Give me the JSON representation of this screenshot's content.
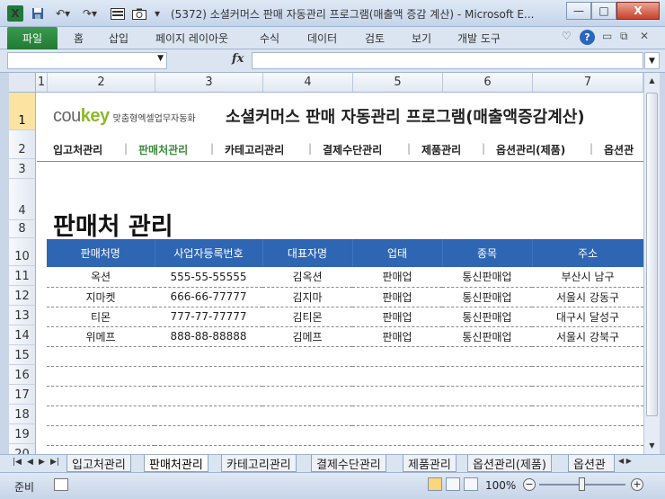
{
  "window": {
    "title": "(5372) 소셜커머스 판매 자동관리 프로그램(매출액 증감 계산) - Microsoft E...",
    "minimize": "—",
    "maximize": "□",
    "close": "X",
    "app_icon": "X",
    "icons": [
      "excel-icon",
      "save-icon",
      "undo-icon",
      "redo-icon",
      "form-icon",
      "camera-icon",
      "customize-icon"
    ]
  },
  "ribbon": {
    "file": "파일",
    "tabs": [
      "홈",
      "삽입",
      "페이지 레이아웃",
      "수식",
      "데이터",
      "검토",
      "보기",
      "개발 도구"
    ],
    "help": "?"
  },
  "formula_bar": {
    "name_box": "",
    "fx": "fx",
    "formula": ""
  },
  "columns": [
    "1",
    "2",
    "3",
    "4",
    "5",
    "6",
    "7"
  ],
  "rows": [
    "1",
    "2",
    "3",
    "4",
    "8",
    "10",
    "11",
    "12",
    "13",
    "14",
    "15",
    "16",
    "17",
    "18",
    "19",
    "20"
  ],
  "header": {
    "brand_prefix": "cou",
    "brand_suffix": "key",
    "tagline": "맞춤형엑셀업무자동화",
    "title": "소셜커머스 판매 자동관리 프로그램(매출액증감계산)"
  },
  "nav": {
    "items": [
      "입고처관리",
      "판매처관리",
      "카테고리관리",
      "결제수단관리",
      "제품관리",
      "옵션관리(제품)",
      "옵션관"
    ],
    "separator": "|",
    "active_index": 1
  },
  "page_title": "판매처 관리",
  "table": {
    "headers": [
      "판매처명",
      "사업자등록번호",
      "대표자명",
      "업태",
      "종목",
      "주소"
    ],
    "rows": [
      [
        "옥션",
        "555-55-55555",
        "김옥션",
        "판매업",
        "통신판매업",
        "부산시 남구"
      ],
      [
        "지마켓",
        "666-66-77777",
        "김지마",
        "판매업",
        "통신판매업",
        "서울시 강동구"
      ],
      [
        "티몬",
        "777-77-77777",
        "김티몬",
        "판매업",
        "통신판매업",
        "대구시 달성구"
      ],
      [
        "위메프",
        "888-88-88888",
        "김메프",
        "판매업",
        "통신판매업",
        "서울시 강북구"
      ],
      [
        "",
        "",
        "",
        "",
        "",
        ""
      ],
      [
        "",
        "",
        "",
        "",
        "",
        ""
      ],
      [
        "",
        "",
        "",
        "",
        "",
        ""
      ],
      [
        "",
        "",
        "",
        "",
        "",
        ""
      ],
      [
        "",
        "",
        "",
        "",
        "",
        ""
      ]
    ]
  },
  "sheet_tabs": {
    "items": [
      "입고처관리",
      "판매처관리",
      "카테고리관리",
      "결제수단관리",
      "제품관리",
      "옵션관리(제품)",
      "옵션관"
    ],
    "active_index": 1
  },
  "status": {
    "ready": "준비",
    "zoom": "100%",
    "zoom_out": "−",
    "zoom_in": "+"
  }
}
